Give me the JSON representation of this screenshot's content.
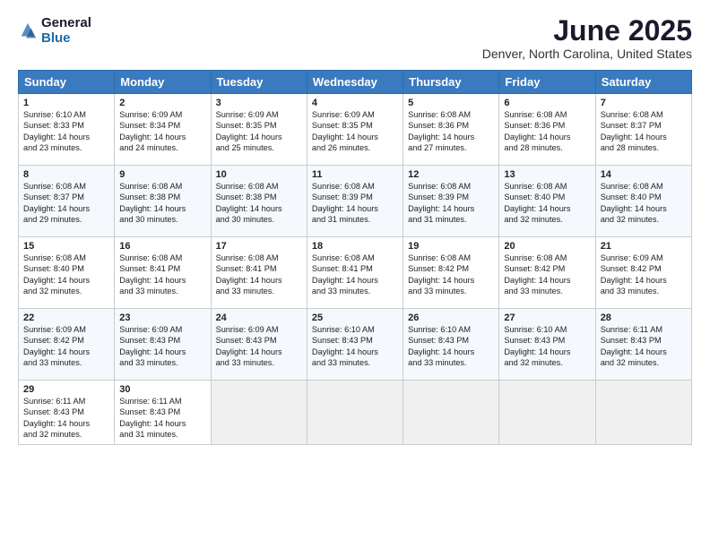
{
  "app": {
    "logo_general": "General",
    "logo_blue": "Blue"
  },
  "header": {
    "title": "June 2025",
    "subtitle": "Denver, North Carolina, United States"
  },
  "weekdays": [
    "Sunday",
    "Monday",
    "Tuesday",
    "Wednesday",
    "Thursday",
    "Friday",
    "Saturday"
  ],
  "weeks": [
    [
      {
        "day": "1",
        "lines": [
          "Sunrise: 6:10 AM",
          "Sunset: 8:33 PM",
          "Daylight: 14 hours",
          "and 23 minutes."
        ]
      },
      {
        "day": "2",
        "lines": [
          "Sunrise: 6:09 AM",
          "Sunset: 8:34 PM",
          "Daylight: 14 hours",
          "and 24 minutes."
        ]
      },
      {
        "day": "3",
        "lines": [
          "Sunrise: 6:09 AM",
          "Sunset: 8:35 PM",
          "Daylight: 14 hours",
          "and 25 minutes."
        ]
      },
      {
        "day": "4",
        "lines": [
          "Sunrise: 6:09 AM",
          "Sunset: 8:35 PM",
          "Daylight: 14 hours",
          "and 26 minutes."
        ]
      },
      {
        "day": "5",
        "lines": [
          "Sunrise: 6:08 AM",
          "Sunset: 8:36 PM",
          "Daylight: 14 hours",
          "and 27 minutes."
        ]
      },
      {
        "day": "6",
        "lines": [
          "Sunrise: 6:08 AM",
          "Sunset: 8:36 PM",
          "Daylight: 14 hours",
          "and 28 minutes."
        ]
      },
      {
        "day": "7",
        "lines": [
          "Sunrise: 6:08 AM",
          "Sunset: 8:37 PM",
          "Daylight: 14 hours",
          "and 28 minutes."
        ]
      }
    ],
    [
      {
        "day": "8",
        "lines": [
          "Sunrise: 6:08 AM",
          "Sunset: 8:37 PM",
          "Daylight: 14 hours",
          "and 29 minutes."
        ]
      },
      {
        "day": "9",
        "lines": [
          "Sunrise: 6:08 AM",
          "Sunset: 8:38 PM",
          "Daylight: 14 hours",
          "and 30 minutes."
        ]
      },
      {
        "day": "10",
        "lines": [
          "Sunrise: 6:08 AM",
          "Sunset: 8:38 PM",
          "Daylight: 14 hours",
          "and 30 minutes."
        ]
      },
      {
        "day": "11",
        "lines": [
          "Sunrise: 6:08 AM",
          "Sunset: 8:39 PM",
          "Daylight: 14 hours",
          "and 31 minutes."
        ]
      },
      {
        "day": "12",
        "lines": [
          "Sunrise: 6:08 AM",
          "Sunset: 8:39 PM",
          "Daylight: 14 hours",
          "and 31 minutes."
        ]
      },
      {
        "day": "13",
        "lines": [
          "Sunrise: 6:08 AM",
          "Sunset: 8:40 PM",
          "Daylight: 14 hours",
          "and 32 minutes."
        ]
      },
      {
        "day": "14",
        "lines": [
          "Sunrise: 6:08 AM",
          "Sunset: 8:40 PM",
          "Daylight: 14 hours",
          "and 32 minutes."
        ]
      }
    ],
    [
      {
        "day": "15",
        "lines": [
          "Sunrise: 6:08 AM",
          "Sunset: 8:40 PM",
          "Daylight: 14 hours",
          "and 32 minutes."
        ]
      },
      {
        "day": "16",
        "lines": [
          "Sunrise: 6:08 AM",
          "Sunset: 8:41 PM",
          "Daylight: 14 hours",
          "and 33 minutes."
        ]
      },
      {
        "day": "17",
        "lines": [
          "Sunrise: 6:08 AM",
          "Sunset: 8:41 PM",
          "Daylight: 14 hours",
          "and 33 minutes."
        ]
      },
      {
        "day": "18",
        "lines": [
          "Sunrise: 6:08 AM",
          "Sunset: 8:41 PM",
          "Daylight: 14 hours",
          "and 33 minutes."
        ]
      },
      {
        "day": "19",
        "lines": [
          "Sunrise: 6:08 AM",
          "Sunset: 8:42 PM",
          "Daylight: 14 hours",
          "and 33 minutes."
        ]
      },
      {
        "day": "20",
        "lines": [
          "Sunrise: 6:08 AM",
          "Sunset: 8:42 PM",
          "Daylight: 14 hours",
          "and 33 minutes."
        ]
      },
      {
        "day": "21",
        "lines": [
          "Sunrise: 6:09 AM",
          "Sunset: 8:42 PM",
          "Daylight: 14 hours",
          "and 33 minutes."
        ]
      }
    ],
    [
      {
        "day": "22",
        "lines": [
          "Sunrise: 6:09 AM",
          "Sunset: 8:42 PM",
          "Daylight: 14 hours",
          "and 33 minutes."
        ]
      },
      {
        "day": "23",
        "lines": [
          "Sunrise: 6:09 AM",
          "Sunset: 8:43 PM",
          "Daylight: 14 hours",
          "and 33 minutes."
        ]
      },
      {
        "day": "24",
        "lines": [
          "Sunrise: 6:09 AM",
          "Sunset: 8:43 PM",
          "Daylight: 14 hours",
          "and 33 minutes."
        ]
      },
      {
        "day": "25",
        "lines": [
          "Sunrise: 6:10 AM",
          "Sunset: 8:43 PM",
          "Daylight: 14 hours",
          "and 33 minutes."
        ]
      },
      {
        "day": "26",
        "lines": [
          "Sunrise: 6:10 AM",
          "Sunset: 8:43 PM",
          "Daylight: 14 hours",
          "and 33 minutes."
        ]
      },
      {
        "day": "27",
        "lines": [
          "Sunrise: 6:10 AM",
          "Sunset: 8:43 PM",
          "Daylight: 14 hours",
          "and 32 minutes."
        ]
      },
      {
        "day": "28",
        "lines": [
          "Sunrise: 6:11 AM",
          "Sunset: 8:43 PM",
          "Daylight: 14 hours",
          "and 32 minutes."
        ]
      }
    ],
    [
      {
        "day": "29",
        "lines": [
          "Sunrise: 6:11 AM",
          "Sunset: 8:43 PM",
          "Daylight: 14 hours",
          "and 32 minutes."
        ]
      },
      {
        "day": "30",
        "lines": [
          "Sunrise: 6:11 AM",
          "Sunset: 8:43 PM",
          "Daylight: 14 hours",
          "and 31 minutes."
        ]
      },
      {
        "day": "",
        "lines": []
      },
      {
        "day": "",
        "lines": []
      },
      {
        "day": "",
        "lines": []
      },
      {
        "day": "",
        "lines": []
      },
      {
        "day": "",
        "lines": []
      }
    ]
  ]
}
